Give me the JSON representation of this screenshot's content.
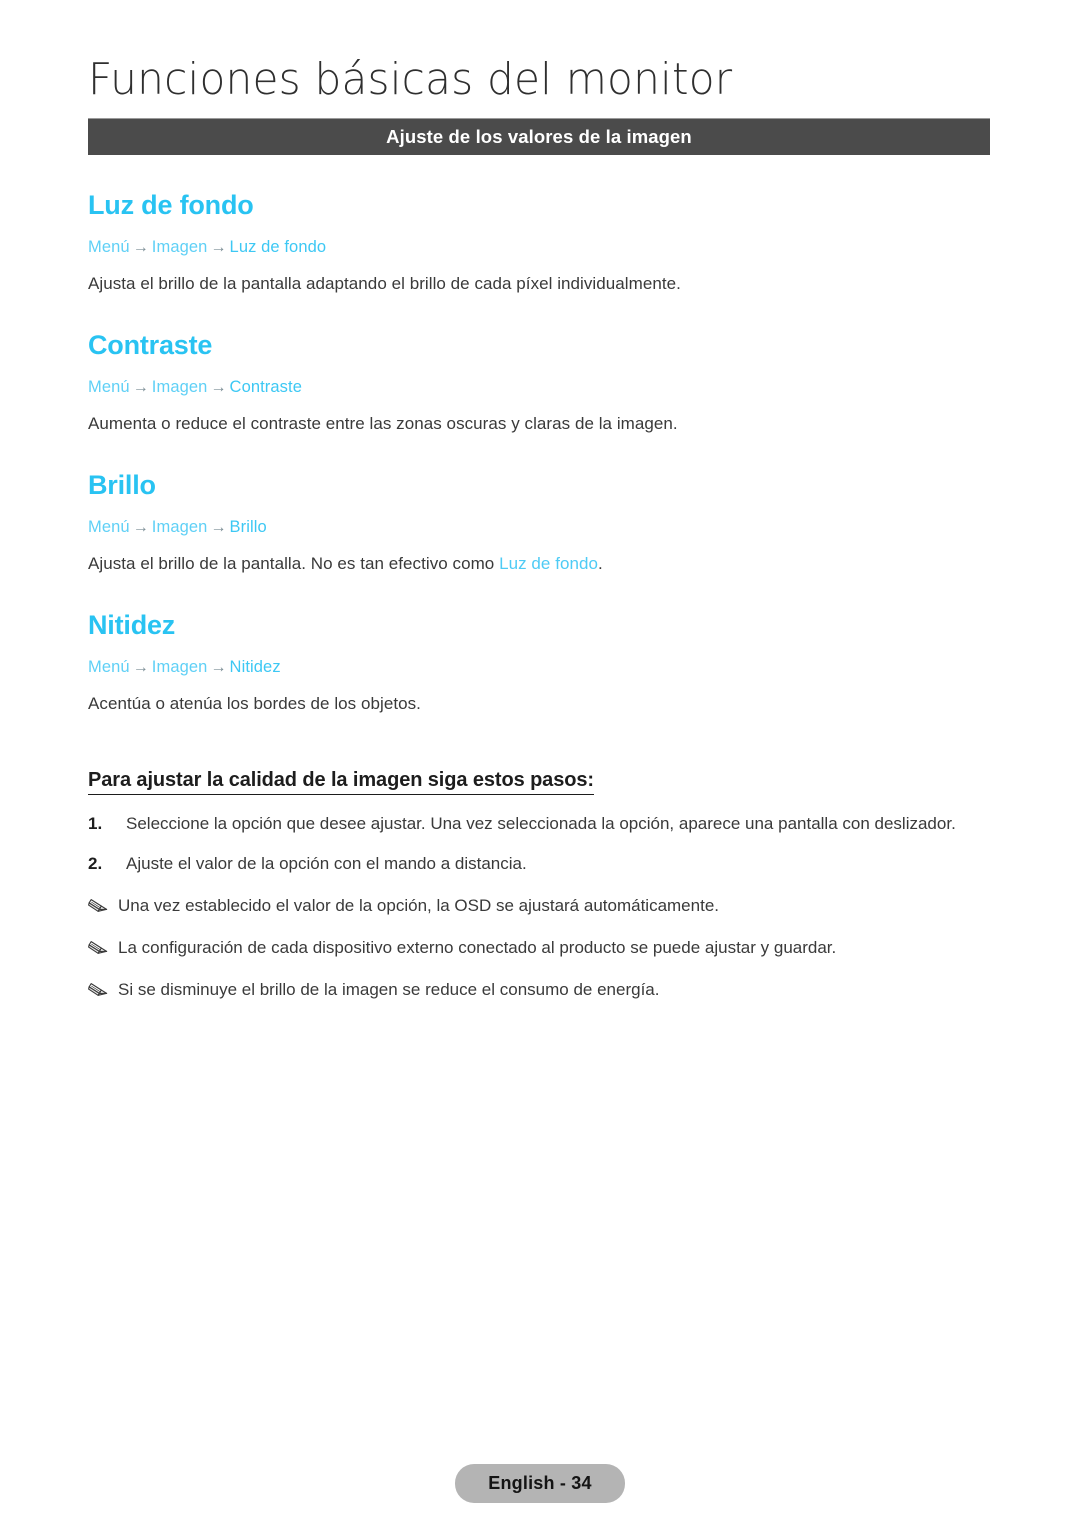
{
  "document": {
    "title": "Funciones básicas del monitor",
    "section_bar_label": "Ajuste de los valores de la imagen"
  },
  "features": [
    {
      "title": "Luz de fondo",
      "path": {
        "root": "Menú",
        "middle": "Imagen",
        "leaf": "Luz de fondo",
        "arrow": "→"
      },
      "description": "Ajusta el brillo de la pantalla adaptando el brillo de cada píxel individualmente."
    },
    {
      "title": "Contraste",
      "path": {
        "root": "Menú",
        "middle": "Imagen",
        "leaf": "Contraste",
        "arrow": "→"
      },
      "description": "Aumenta o reduce el contraste entre las zonas oscuras y claras de la imagen."
    },
    {
      "title": "Brillo",
      "path": {
        "root": "Menú",
        "middle": "Imagen",
        "leaf": "Brillo",
        "arrow": "→"
      },
      "description_before": "Ajusta el brillo de la pantalla. No es tan efectivo como ",
      "description_link": "Luz de fondo",
      "description_after": "."
    },
    {
      "title": "Nitidez",
      "path": {
        "root": "Menú",
        "middle": "Imagen",
        "leaf": "Nitidez",
        "arrow": "→"
      },
      "description": "Acentúa o atenúa los bordes de los objetos."
    }
  ],
  "steps_block": {
    "heading": "Para ajustar la calidad de la imagen siga estos pasos:",
    "steps": [
      {
        "number": "1.",
        "text": "Seleccione la opción que desee ajustar. Una vez seleccionada la opción, aparece una pantalla con deslizador."
      },
      {
        "number": "2.",
        "text": "Ajuste el valor de la opción con el mando a distancia."
      }
    ],
    "notes": [
      {
        "icon": "pencil-note-icon",
        "text": "Una vez establecido el valor de la opción, la OSD se ajustará automáticamente."
      },
      {
        "icon": "pencil-note-icon",
        "text": "La configuración de cada dispositivo externo conectado al producto se puede ajustar y guardar."
      },
      {
        "icon": "pencil-note-icon",
        "text": "Si se disminuye el brillo de la imagen se reduce el consumo de energía."
      }
    ]
  },
  "footer": {
    "page_label": "English - 34"
  },
  "colors": {
    "accent_cyan": "#29c3f2",
    "path_cyan": "#5fd0f6",
    "section_bar_bg": "#4b4b4b",
    "body_text": "#3a3a3a",
    "badge_bg": "#b4b4b4"
  }
}
